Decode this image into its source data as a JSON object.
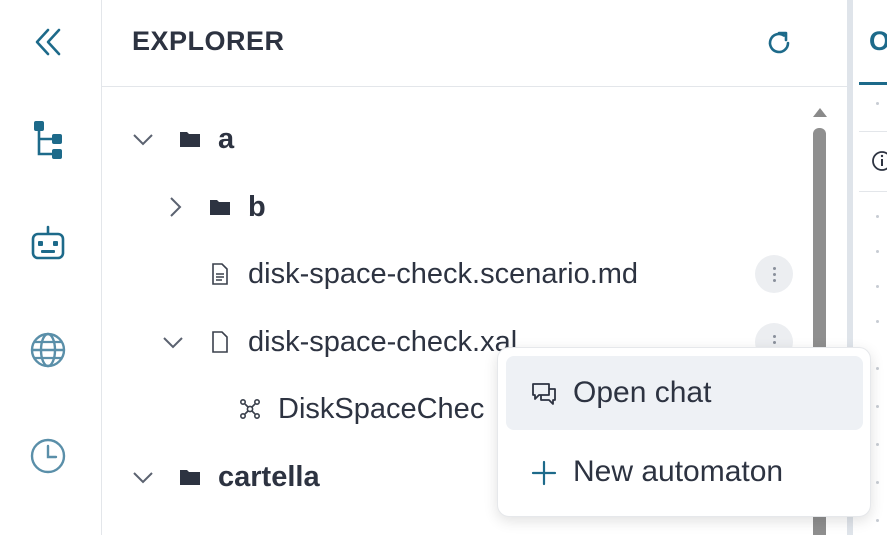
{
  "activity_bar": {
    "items": [
      {
        "icon": "collapse-double-chevron-icon"
      },
      {
        "icon": "tree-hierarchy-icon"
      },
      {
        "icon": "robot-icon"
      },
      {
        "icon": "globe-icon"
      },
      {
        "icon": "clock-icon"
      }
    ],
    "accent_color": "#1d6a8a"
  },
  "explorer": {
    "title": "EXPLORER",
    "refresh_icon": "refresh-icon",
    "tree": [
      {
        "label": "a",
        "type": "folder",
        "expanded": true
      },
      {
        "label": "b",
        "type": "folder",
        "expanded": false
      },
      {
        "label": "disk-space-check.scenario.md",
        "type": "file"
      },
      {
        "label": "disk-space-check.xal",
        "type": "file",
        "expanded": true
      },
      {
        "label": "DiskSpaceChec",
        "type": "automaton"
      },
      {
        "label": "cartella",
        "type": "folder",
        "expanded": true
      }
    ]
  },
  "context_menu": {
    "items": [
      {
        "label": "Open chat",
        "icon": "chat-bubbles-icon"
      },
      {
        "label": "New automaton",
        "icon": "plus-icon"
      }
    ]
  },
  "right_panel": {
    "active_tab_label": "O"
  }
}
